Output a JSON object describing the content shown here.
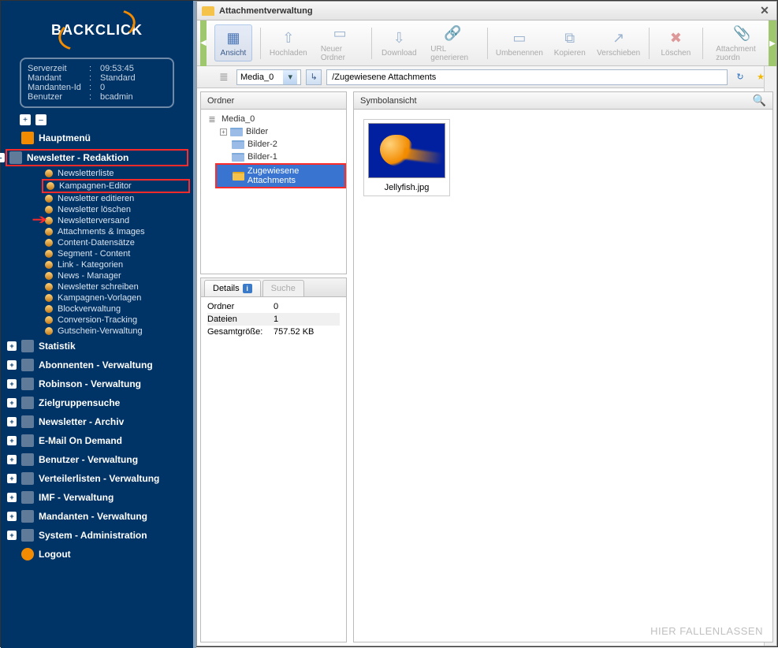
{
  "logo": "BACKCLICK",
  "info": {
    "serverzeit_label": "Serverzeit",
    "serverzeit": "09:53:45",
    "mandant_label": "Mandant",
    "mandant": "Standard",
    "mandant_id_label": "Mandanten-Id",
    "mandant_id": "0",
    "benutzer_label": "Benutzer",
    "benutzer": "bcadmin"
  },
  "menu": {
    "haupt": "Hauptmenü",
    "newsletter_redaktion": "Newsletter - Redaktion",
    "sub": [
      "Newsletterliste",
      "Kampagnen-Editor",
      "Newsletter editieren",
      "Newsletter löschen",
      "Newsletterversand",
      "Attachments & Images",
      "Content-Datensätze",
      "Segment - Content",
      "Link - Kategorien",
      "News - Manager",
      "Newsletter schreiben",
      "Kampagnen-Vorlagen",
      "Blockverwaltung",
      "Conversion-Tracking",
      "Gutschein-Verwaltung"
    ],
    "others": [
      "Statistik",
      "Abonnenten - Verwaltung",
      "Robinson - Verwaltung",
      "Zielgruppensuche",
      "Newsletter - Archiv",
      "E-Mail On Demand",
      "Benutzer - Verwaltung",
      "Verteilerlisten - Verwaltung",
      "IMF - Verwaltung",
      "Mandanten - Verwaltung",
      "System - Administration"
    ],
    "logout": "Logout"
  },
  "window": {
    "title": "Attachmentverwaltung"
  },
  "toolbar": {
    "ansicht": "Ansicht",
    "hochladen": "Hochladen",
    "neuer_ordner": "Neuer Ordner",
    "download": "Download",
    "url": "URL generieren",
    "umbenennen": "Umbenennen",
    "kopieren": "Kopieren",
    "verschieben": "Verschieben",
    "loeschen": "Löschen",
    "attachment_zuordn": "Attachment zuordn"
  },
  "addr": {
    "media": "Media_0",
    "path": "/Zugewiesene Attachments"
  },
  "folder_panel": {
    "title": "Ordner",
    "root": "Media_0",
    "bilder": "Bilder",
    "bilder2": "Bilder-2",
    "bilder1": "Bilder-1",
    "zugewiesene": "Zugewiesene Attachments"
  },
  "detail_tabs": {
    "details": "Details",
    "suche": "Suche"
  },
  "details": {
    "ordner_label": "Ordner",
    "ordner": "0",
    "dateien_label": "Dateien",
    "dateien": "1",
    "groesse_label": "Gesamtgröße:",
    "groesse": "757.52 KB"
  },
  "symbol_panel": {
    "title": "Symbolansicht"
  },
  "file": {
    "name": "Jellyfish.jpg"
  },
  "drop_hint": "HIER FALLENLASSEN"
}
